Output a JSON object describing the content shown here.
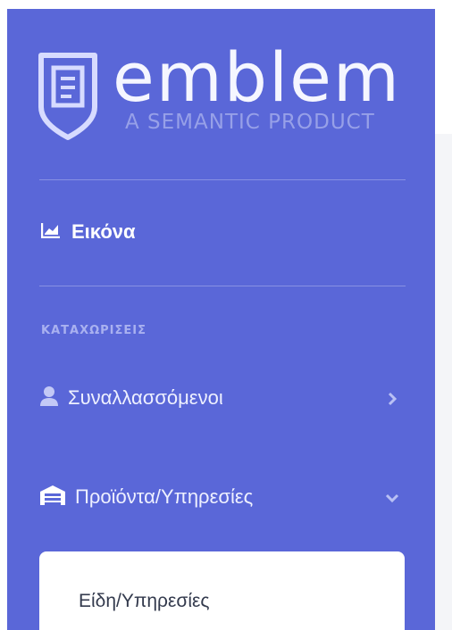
{
  "brand": {
    "name": "emblem",
    "tagline": "A SEMANTIC PRODUCT"
  },
  "nav": {
    "dashboard_label": "Εικόνα",
    "section_heading": "ΚΑΤΑΧΩΡΙΣΕΙΣ",
    "items": [
      {
        "label": "Συναλλασσόμενοι",
        "icon": "user-icon",
        "expanded": false
      },
      {
        "label": "Προϊόντα/Υπηρεσίες",
        "icon": "warehouse-icon",
        "expanded": true
      }
    ],
    "submenu": [
      {
        "label": "Είδη/Υπηρεσίες"
      }
    ]
  },
  "colors": {
    "sidebar_bg": "#5a67d8",
    "submenu_bg": "#ffffff",
    "section_heading": "#a9b1f0",
    "submenu_text": "#333a4d"
  }
}
